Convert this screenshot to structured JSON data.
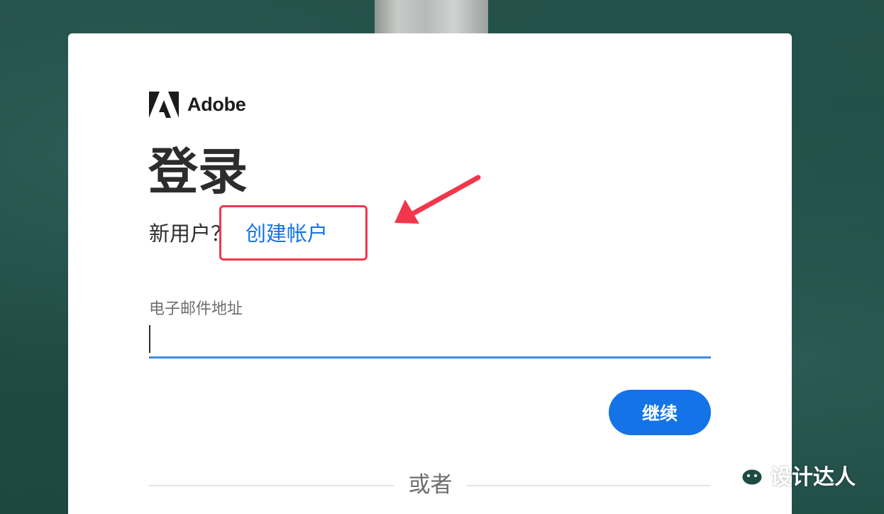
{
  "brand": {
    "logo_icon": "adobe-logo-icon",
    "name": "Adobe"
  },
  "page": {
    "title": "登录"
  },
  "signup": {
    "prompt": "新用户？",
    "link_label": "创建帐户"
  },
  "email": {
    "label": "电子邮件地址",
    "value": ""
  },
  "actions": {
    "continue_label": "继续"
  },
  "separator": {
    "label": "或者"
  },
  "watermark": {
    "icon": "wechat-icon",
    "text": "设计达人"
  },
  "colors": {
    "accent": "#1473e6",
    "highlight": "#f2374d",
    "background": "#1f4a44"
  }
}
